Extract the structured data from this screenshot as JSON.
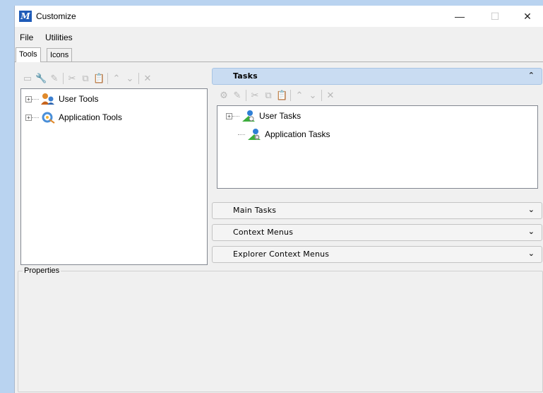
{
  "window": {
    "title": "Customize",
    "app_icon_glyph": "M",
    "controls": {
      "minimize": "—",
      "maximize": "☐",
      "close": "✕"
    }
  },
  "menu": [
    "File",
    "Utilities"
  ],
  "tabs": [
    "Tools",
    "Icons"
  ],
  "tools_tree": {
    "items": [
      {
        "label": "User Tools",
        "icon": "user-tools-icon"
      },
      {
        "label": "Application Tools",
        "icon": "application-tools-icon"
      }
    ]
  },
  "tasks_panel": {
    "header": "Tasks",
    "items": [
      {
        "label": "User Tasks",
        "icon": "user-tasks-icon"
      },
      {
        "label": "Application Tasks",
        "icon": "application-tasks-icon"
      }
    ]
  },
  "accordion": [
    {
      "label": "Main Tasks"
    },
    {
      "label": "Context Menus"
    },
    {
      "label": "Explorer Context Menus"
    }
  ],
  "properties": {
    "label": "Properties"
  },
  "colors": {
    "desktop": "#b9d3f0",
    "window_bg": "#f0f0f0",
    "active_header": "#c9dcf2",
    "app_icon": "#1e5bb8"
  }
}
